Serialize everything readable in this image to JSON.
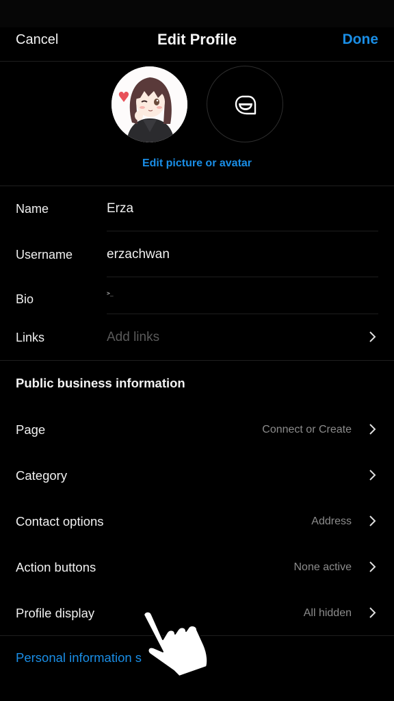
{
  "header": {
    "cancel_label": "Cancel",
    "title": "Edit Profile",
    "done_label": "Done"
  },
  "avatar": {
    "photo_icon": "anime-girl-profile-photo",
    "avatar_icon": "smiling-avatar-bubble-icon",
    "edit_label": "Edit picture or avatar"
  },
  "fields": {
    "name": {
      "label": "Name",
      "value": "Erza"
    },
    "username": {
      "label": "Username",
      "value": "erzachwan"
    },
    "bio": {
      "label": "Bio",
      "value": ">_"
    },
    "links": {
      "label": "Links",
      "placeholder": "Add links"
    }
  },
  "business": {
    "title": "Public business information",
    "rows": [
      {
        "label": "Page",
        "value": "Connect or Create"
      },
      {
        "label": "Category",
        "value": ""
      },
      {
        "label": "Contact options",
        "value": "Address"
      },
      {
        "label": "Action buttons",
        "value": "None active"
      },
      {
        "label": "Profile display",
        "value": "All hidden"
      }
    ]
  },
  "footer": {
    "personal_info_label": "Personal information s"
  },
  "overlay": {
    "pointer_icon": "tap-hand-pointer"
  },
  "colors": {
    "accent": "#1a8ee6",
    "background": "#000000",
    "secondary_text": "#8c8c8c",
    "placeholder": "#5a5a5a"
  }
}
